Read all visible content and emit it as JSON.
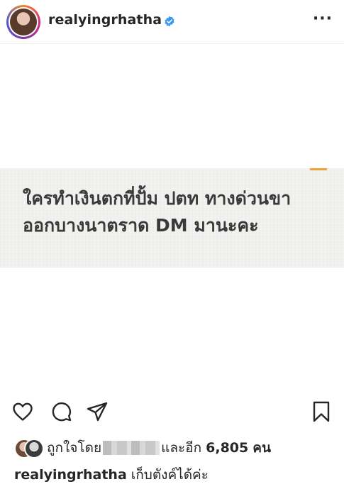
{
  "header": {
    "username": "realyingrhatha",
    "more_label": "···",
    "accent_verified": "#3897f0"
  },
  "post": {
    "image_text_line1": "ใครทำเงินตกที่ปั้ม ปตท ทางด่วนขา",
    "image_text_line2": "ออกบางนาตราด DM มานะคะ"
  },
  "likes": {
    "prefix": "ถูกใจโดย",
    "and_more": "และอีก",
    "count": "6,805",
    "suffix": "คน"
  },
  "caption": {
    "username": "realyingrhatha",
    "text": "เก็บตังค์ได้ค่ะ"
  },
  "icons": [
    "heart-icon",
    "comment-icon",
    "share-icon",
    "bookmark-icon",
    "verified-icon",
    "more-icon"
  ]
}
